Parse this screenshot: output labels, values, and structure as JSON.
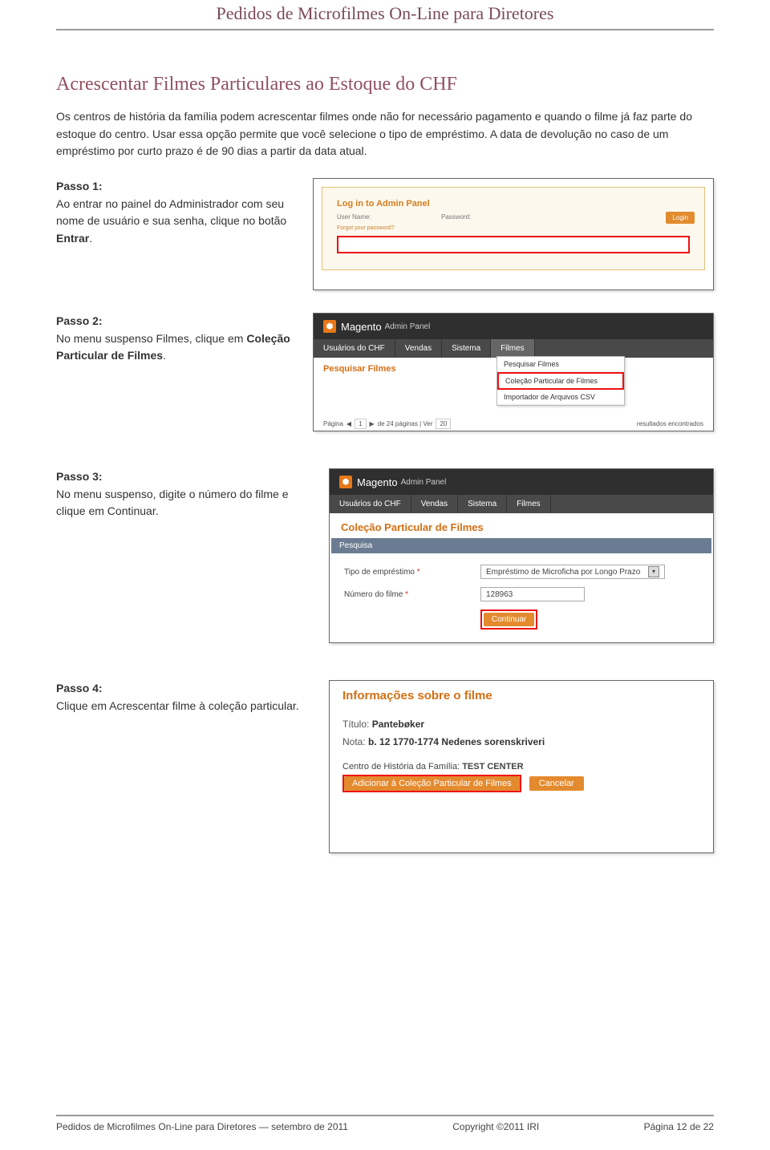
{
  "header": {
    "title": "Pedidos de Microfilmes On-Line para Diretores"
  },
  "section": {
    "title": "Acrescentar Filmes Particulares ao Estoque do CHF",
    "intro": "Os centros de história da família podem acrescentar filmes onde não for necessário pagamento e quando o filme já faz parte do estoque do centro. Usar essa opção permite que você selecione o tipo de empréstimo. A data de devolução no caso de um empréstimo por curto prazo é de 90 dias a partir da data atual."
  },
  "steps": {
    "s1": {
      "label": "Passo 1:",
      "body_a": "Ao entrar no painel do Administrador com seu nome de usuário e sua senha, clique no botão ",
      "body_b": "Entrar",
      "body_c": "."
    },
    "s2": {
      "label": "Passo 2:",
      "body_a": "No menu suspenso Filmes, clique em ",
      "body_b": "Coleção Particular de Filmes",
      "body_c": "."
    },
    "s3": {
      "label": "Passo 3:",
      "body": "No menu suspenso, digite o número do filme e clique em Continuar."
    },
    "s4": {
      "label": "Passo 4:",
      "body": "Clique em Acrescentar filme à coleção particular."
    }
  },
  "shots": {
    "login": {
      "title": "Log in to Admin Panel",
      "user": "User Name:",
      "pass": "Password:",
      "forgot": "Forgot your password?",
      "btn": "Login"
    },
    "menu": {
      "brand": "Magento",
      "panel": "Admin Panel",
      "nav": [
        "Usuários do CHF",
        "Vendas",
        "Sistema",
        "Filmes"
      ],
      "search": "Pesquisar Filmes",
      "dd": [
        "Pesquisar Filmes",
        "Coleção Particular de Filmes",
        "Importador de Arquivos CSV"
      ],
      "pager_a": "Página",
      "pager_page": "1",
      "pager_b": "de 24 páginas  |  Ver",
      "pager_per": "20",
      "pager_c": "resultados encontrados"
    },
    "form": {
      "crumb": "Coleção Particular de Filmes",
      "bar": "Pesquisa",
      "f1_label": "Tipo de empréstimo",
      "f1_value": "Empréstimo de Microficha por Longo Prazo",
      "f2_label": "Número do filme",
      "f2_value": "128963",
      "btn": "Continuar"
    },
    "info": {
      "title": "Informações sobre o filme",
      "t_lbl": "Título:",
      "t_val": "Pantebøker",
      "n_lbl": "Nota:",
      "n_val": "b. 12 1770-1774 Nedenes sorenskriveri",
      "c_lbl": "Centro de História da Família:",
      "c_val": "TEST CENTER",
      "add": "Adicionar à Coleção Particular de Filmes",
      "cancel": "Cancelar"
    }
  },
  "footer": {
    "left": "Pedidos de Microfilmes On-Line para Diretores — setembro de 2011",
    "center": "Copyright ©2011 IRI",
    "right": "Página 12 de 22"
  }
}
